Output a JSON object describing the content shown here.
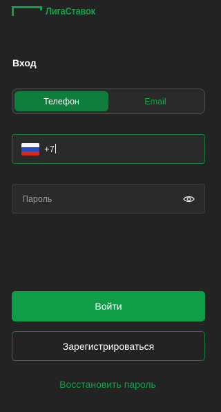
{
  "brand": {
    "name": "ЛигаСтавок",
    "color": "#12a04a"
  },
  "title": "Вход",
  "tabs": [
    {
      "label": "Телефон",
      "active": true
    },
    {
      "label": "Email",
      "active": false
    }
  ],
  "phone": {
    "country_flag": "russia-flag-icon",
    "value": "+7"
  },
  "password": {
    "placeholder": "Пароль",
    "toggle_icon": "eye-icon"
  },
  "buttons": {
    "login": "Войти",
    "register": "Зарегистрироваться",
    "restore": "Восстановить пароль"
  },
  "colors": {
    "background": "#232323",
    "accent": "#0f9d48",
    "accent_dark": "#0f7d3c",
    "accent_text": "#12a04a"
  }
}
